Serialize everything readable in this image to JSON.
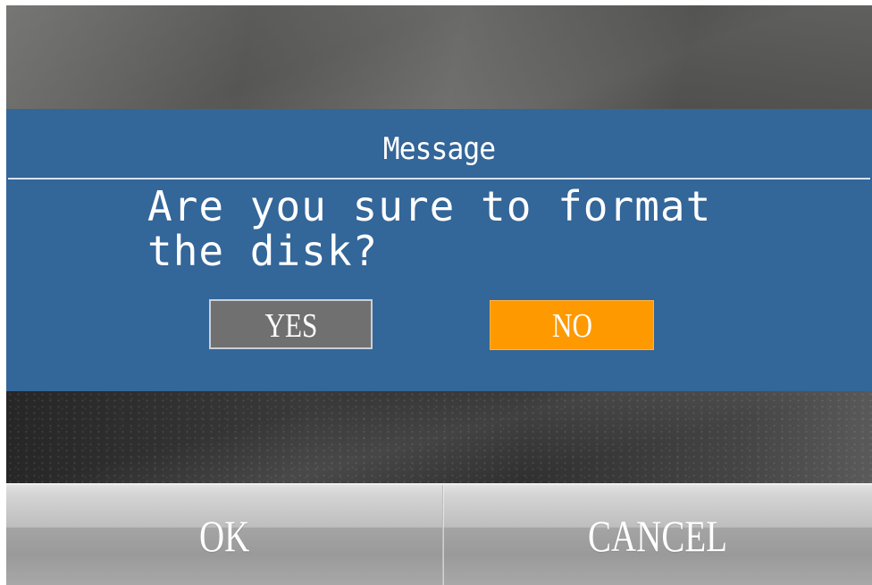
{
  "dialog": {
    "title": "Message",
    "message": "Are you sure to format\nthe disk?",
    "yes_label": "YES",
    "no_label": "NO",
    "selected": "NO"
  },
  "softkeys": {
    "ok_label": "OK",
    "cancel_label": "CANCEL"
  },
  "colors": {
    "dialog_bg": "#336699",
    "yes_bg": "#707070",
    "no_bg_selected": "#ff9900",
    "text": "#ffffff"
  }
}
